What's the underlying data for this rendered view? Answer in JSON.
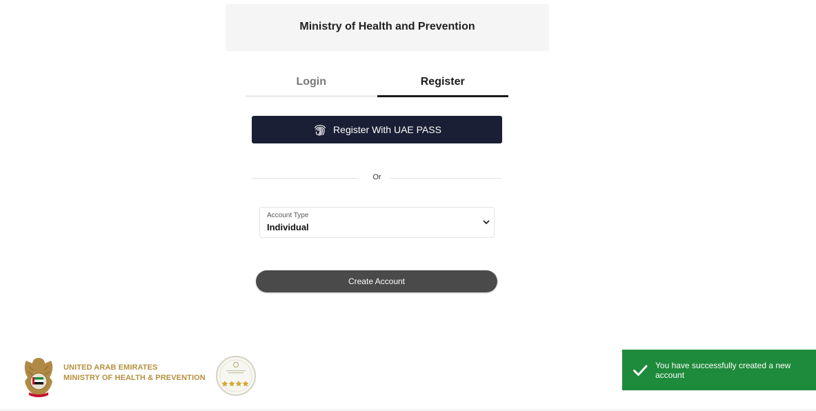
{
  "header": {
    "title": "Ministry of Health and Prevention"
  },
  "tabs": [
    {
      "label": "Login",
      "active": false
    },
    {
      "label": "Register",
      "active": true
    }
  ],
  "uae_pass": {
    "label": "Register With UAE PASS",
    "icon": "fingerprint-icon"
  },
  "divider": {
    "label": "Or"
  },
  "account_type": {
    "label": "Account Type",
    "value": "Individual"
  },
  "create_button": {
    "label": "Create Account"
  },
  "footer": {
    "line1": "UNITED ARAB EMIRATES",
    "line2": "MINISTRY OF HEALTH & PREVENTION"
  },
  "toast": {
    "message": "You have successfully created a new account",
    "icon": "checkmark-icon"
  },
  "colors": {
    "uae_pass_bg": "#1b1f35",
    "create_button_bg": "#4a4a4a",
    "toast_bg": "#1e8a3b",
    "footer_gold": "#b5903f"
  }
}
